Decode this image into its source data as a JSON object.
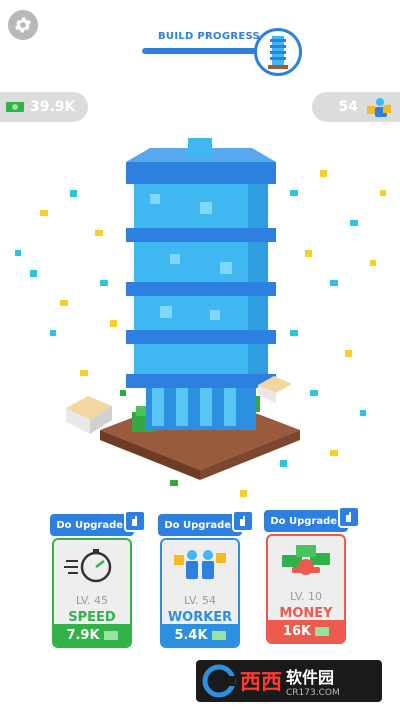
{
  "hud": {
    "build_progress_label": "BUILD PROGRESS",
    "build_progress_fraction": 0.95,
    "money_value": "39.9K",
    "workers_value": "54"
  },
  "upgrades": [
    {
      "tag": "Do Upgrade!",
      "level": "LV. 45",
      "name": "SPEED",
      "price": "7.9K",
      "theme": "#34b24a",
      "icon": "stopwatch-icon"
    },
    {
      "tag": "Do Upgrade!",
      "level": "LV. 54",
      "name": "WORKER",
      "price": "5.4K",
      "theme": "#2d8fe0",
      "icon": "workers-icon"
    },
    {
      "tag": "Do Upgrade!",
      "level": "LV. 10",
      "name": "MONEY",
      "price": "16K",
      "theme": "#ec5b4e",
      "icon": "money-stack-icon"
    }
  ],
  "watermark": {
    "title": "西西",
    "name": "软件园",
    "url": "CR173.COM"
  },
  "colors": {
    "accent": "#2d7fe0",
    "tower": "#3fb8f2",
    "ground": "#9a5a3c"
  }
}
